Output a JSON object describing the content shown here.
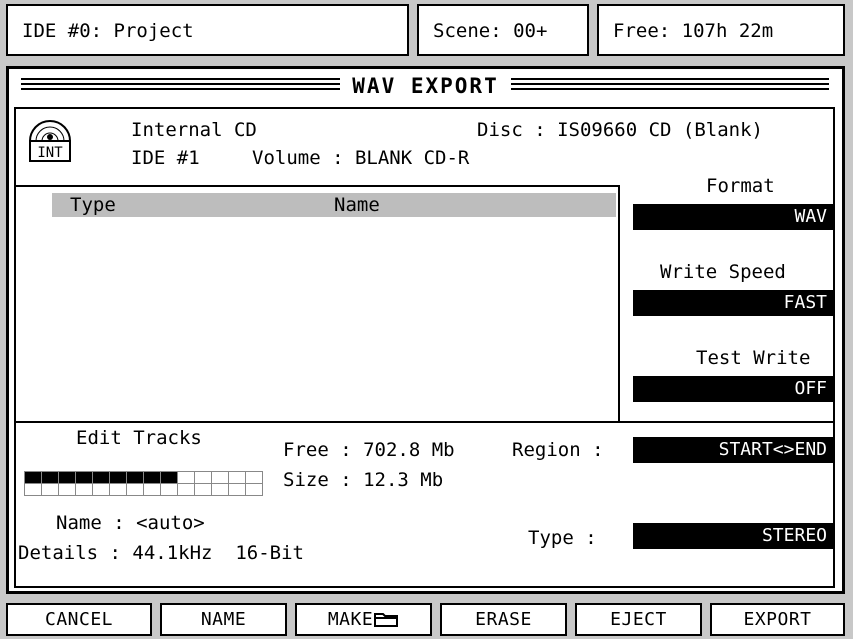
{
  "status": {
    "project": "IDE #0: Project",
    "scene": "Scene: 00+",
    "free": "Free: 107h 22m"
  },
  "title": "WAV EXPORT",
  "drive": {
    "icon": "cd-drive-icon",
    "icon_label": "INT",
    "name": "Internal CD",
    "id": "IDE #1",
    "disc": "Disc : IS09660 CD (Blank)",
    "volume": "Volume : BLANK CD-R"
  },
  "list": {
    "columns": [
      "Type",
      "Name"
    ]
  },
  "settings": {
    "format_label": "Format",
    "format_value": "WAV",
    "speed_label": "Write Speed",
    "speed_value": "FAST",
    "test_label": "Test Write",
    "test_value": "OFF"
  },
  "edit": {
    "tracks_label": "Edit Tracks",
    "tracks_selected": 9,
    "tracks_total": 14,
    "free": "Free : 702.8 Mb",
    "size": "Size : 12.3 Mb",
    "region_label": "Region :",
    "region_value": "START<>END",
    "name": "Name : <auto>",
    "details": "Details : 44.1kHz  16-Bit",
    "type_label": "Type :",
    "type_value": "STEREO"
  },
  "buttons": {
    "cancel": "CANCEL",
    "name": "NAME",
    "make": "MAKE",
    "make_icon": "folder-icon",
    "erase": "ERASE",
    "eject": "EJECT",
    "export": "EXPORT"
  }
}
